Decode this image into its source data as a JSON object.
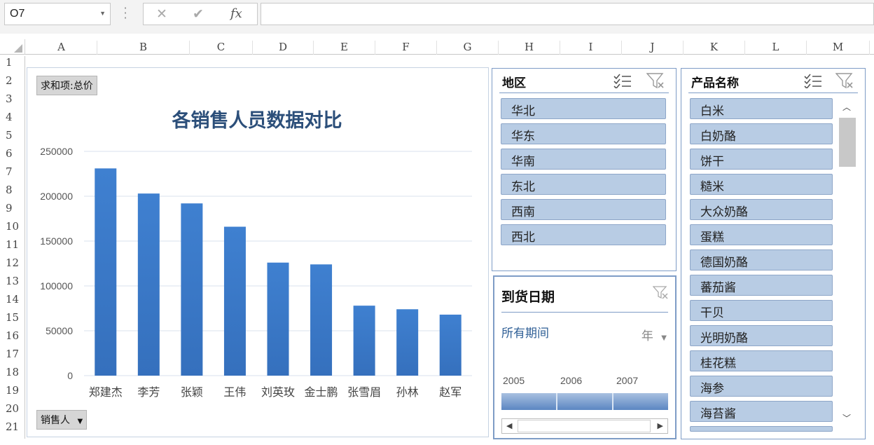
{
  "formula_bar": {
    "cell_ref": "O7",
    "cancel_glyph": "✕",
    "confirm_glyph": "✔",
    "fx_label": "fx",
    "formula": ""
  },
  "columns": [
    "A",
    "B",
    "C",
    "D",
    "E",
    "F",
    "G",
    "H",
    "I",
    "J",
    "K",
    "L",
    "M"
  ],
  "rows": [
    "1",
    "2",
    "3",
    "4",
    "5",
    "6",
    "7",
    "8",
    "9",
    "10",
    "11",
    "12",
    "13",
    "14",
    "15",
    "16",
    "17",
    "18",
    "19",
    "20",
    "21"
  ],
  "pivot_chart": {
    "value_field": "求和项:总价",
    "axis_field": "销售人",
    "axis_field_dropdown": "▼"
  },
  "chart_data": {
    "type": "bar",
    "title": "各销售人员数据对比",
    "categories": [
      "郑建杰",
      "李芳",
      "张颖",
      "王伟",
      "刘英玫",
      "金士鹏",
      "张雪眉",
      "孙林",
      "赵军"
    ],
    "values": [
      231000,
      203000,
      192000,
      166000,
      126000,
      124000,
      78000,
      74000,
      68000
    ],
    "y_ticks": [
      "0",
      "50000",
      "100000",
      "150000",
      "200000",
      "250000"
    ],
    "ylim": [
      0,
      250000
    ],
    "grid": true,
    "legend": "none",
    "bar_color": "#3570bd",
    "xlabel": "",
    "ylabel": ""
  },
  "slicer_region": {
    "title": "地区",
    "items": [
      "华北",
      "华东",
      "华南",
      "东北",
      "西南",
      "西北"
    ]
  },
  "slicer_product": {
    "title": "产品名称",
    "items": [
      "白米",
      "白奶酪",
      "饼干",
      "糙米",
      "大众奶酪",
      "蛋糕",
      "德国奶酪",
      "蕃茄酱",
      "干贝",
      "光明奶酪",
      "桂花糕",
      "海参",
      "海苔酱"
    ]
  },
  "timeline": {
    "title": "到货日期",
    "period": "所有期间",
    "level": "年",
    "years": [
      "2005",
      "2006",
      "2007"
    ]
  },
  "colors": {
    "slicer_item": "#b8cce4",
    "slicer_border": "#7e9cc6",
    "timeline_text": "#2f5f96"
  }
}
